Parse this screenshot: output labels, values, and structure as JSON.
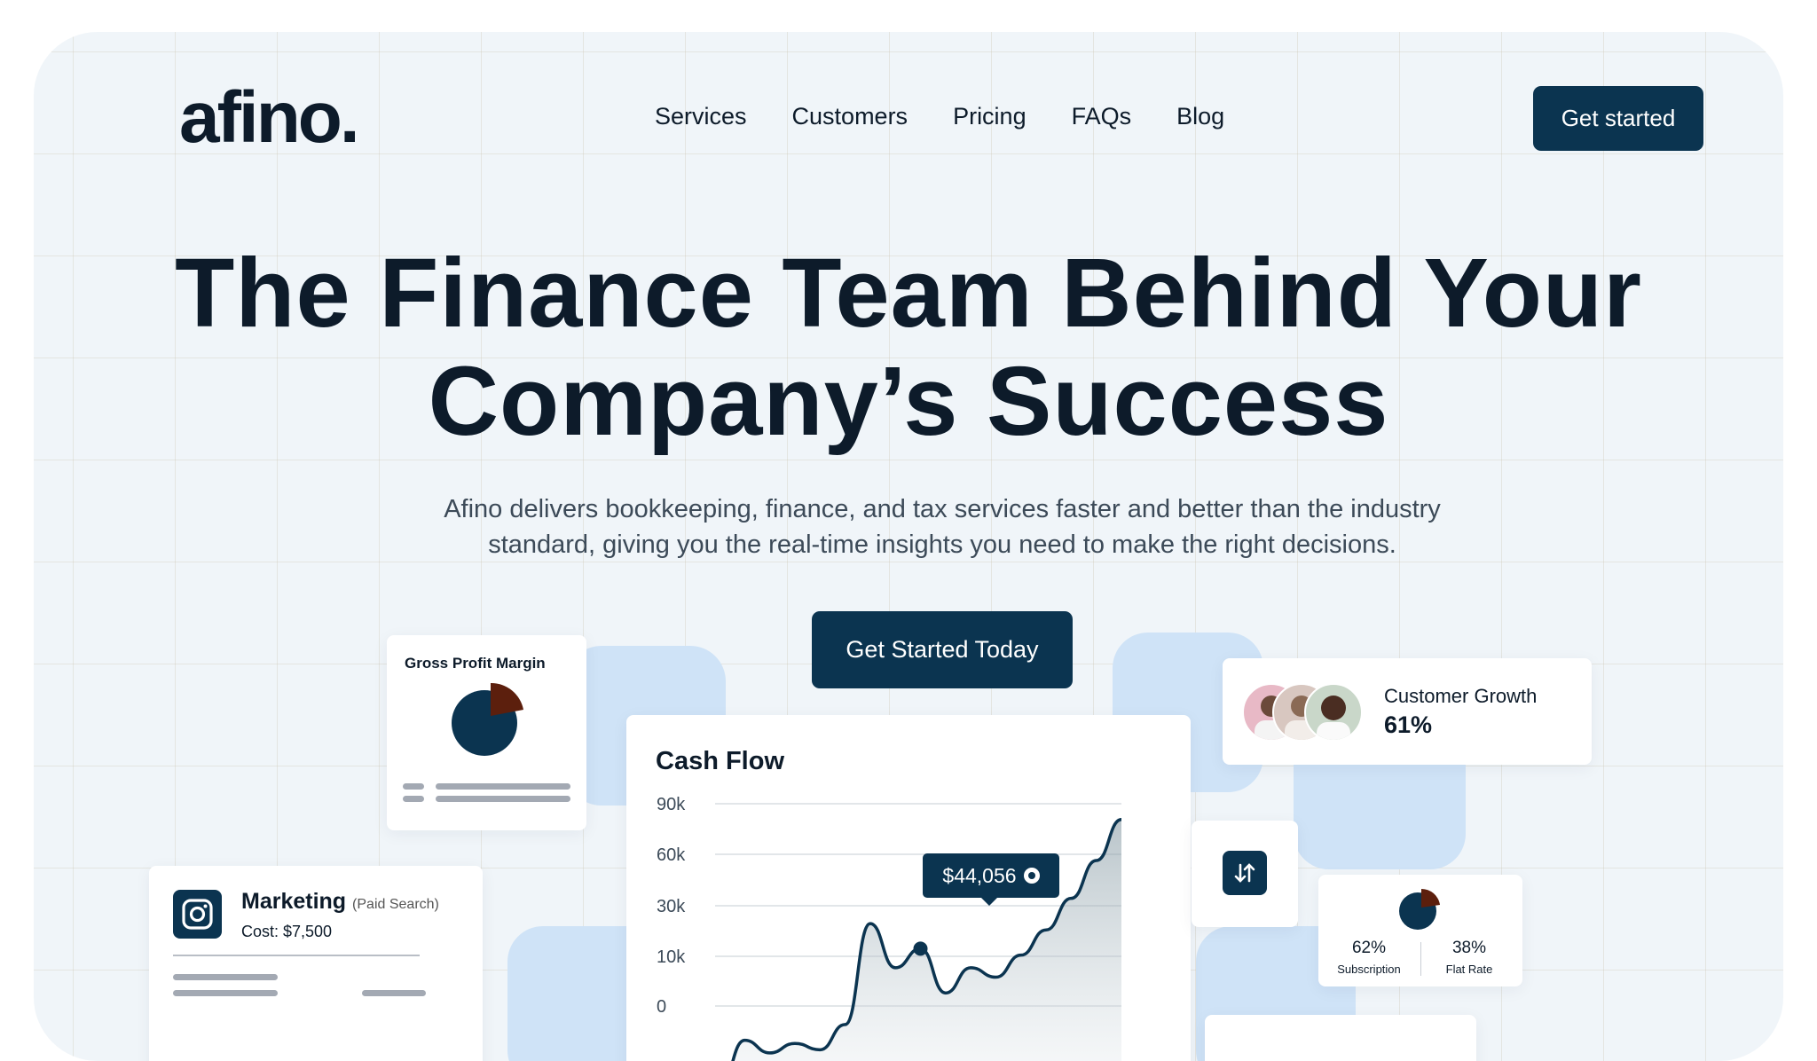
{
  "brand": {
    "logo": "afino.",
    "accent": "#0b3450",
    "accent_dark": "#5c1f0d"
  },
  "nav": [
    {
      "label": "Services"
    },
    {
      "label": "Customers"
    },
    {
      "label": "Pricing"
    },
    {
      "label": "FAQs"
    },
    {
      "label": "Blog"
    }
  ],
  "header": {
    "cta_label": "Get started"
  },
  "hero": {
    "title_line1": "The Finance Team Behind Your",
    "title_line2": "Company’s Success",
    "subtitle_line1": "Afino delivers bookkeeping, finance, and tax services faster and better than the industry",
    "subtitle_line2": "standard, giving you the real-time insights you need to make the right decisions.",
    "cta_label": "Get Started Today"
  },
  "gross_profit_card": {
    "title": "Gross Profit Margin",
    "pie_share": 0.18
  },
  "cash_flow_card": {
    "title": "Cash Flow",
    "tooltip_value": "$44,056",
    "icon": "sort-arrows-icon"
  },
  "customer_growth_card": {
    "label": "Customer Growth",
    "value": "61%",
    "avatars": 3
  },
  "marketing_card": {
    "icon": "instagram-icon",
    "title": "Marketing",
    "qualifier": "(Paid Search)",
    "cost": "Cost: $7,500"
  },
  "revenue_split_card": {
    "left_value": "62%",
    "left_label": "Subscription",
    "right_value": "38%",
    "right_label": "Flat Rate"
  },
  "chart_data": {
    "type": "area",
    "title": "Cash Flow",
    "y_ticks": [
      "90k",
      "60k",
      "30k",
      "10k",
      "0"
    ],
    "ylim": [
      0,
      90000
    ],
    "grid": true,
    "series": [
      {
        "values": [
          0,
          15000,
          11000,
          14000,
          12000,
          20000,
          52000,
          38000,
          44056,
          30000,
          38000,
          35000,
          42000,
          50000,
          60000,
          72000,
          85000
        ]
      }
    ]
  }
}
